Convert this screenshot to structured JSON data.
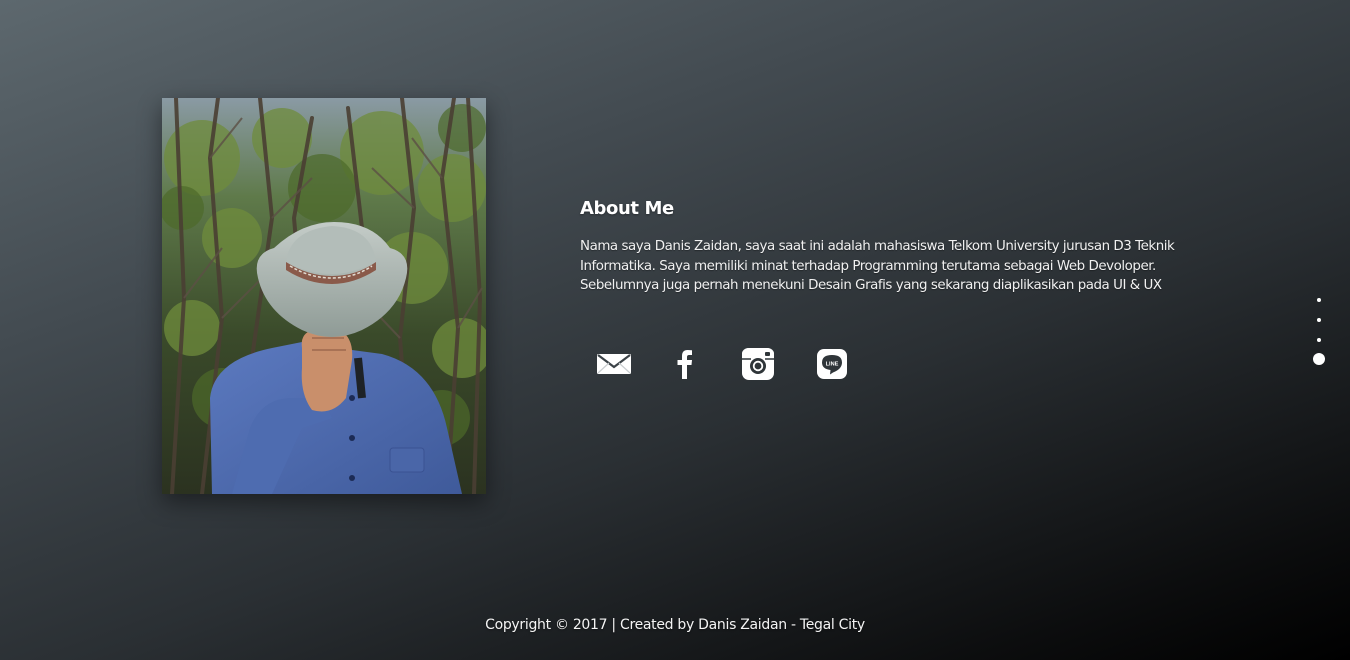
{
  "about": {
    "heading": "About Me",
    "lines": [
      "Nama saya Danis Zaidan, saya saat ini adalah mahasiswa Telkom University jurusan D3 Teknik",
      "Informatika. Saya memiliki minat terhadap Programming terutama sebagai Web Devoloper.",
      "Sebelumnya juga pernah menekuni Desain Grafis yang sekarang diaplikasikan pada UI & UX"
    ]
  },
  "socials": [
    {
      "name": "email",
      "icon": "mail-icon"
    },
    {
      "name": "facebook",
      "icon": "facebook-icon"
    },
    {
      "name": "instagram",
      "icon": "instagram-icon"
    },
    {
      "name": "line",
      "icon": "line-icon",
      "badge": "LINE"
    }
  ],
  "page_nav": {
    "count": 4,
    "active_index": 3
  },
  "footer": {
    "text": "Copyright © 2017 | Created by Danis Zaidan - Tegal City"
  },
  "colors": {
    "text": "#ffffff",
    "shirt": "#4f6cb0",
    "hat": "#a9b5b1",
    "foliage": "#3d5a2a"
  }
}
